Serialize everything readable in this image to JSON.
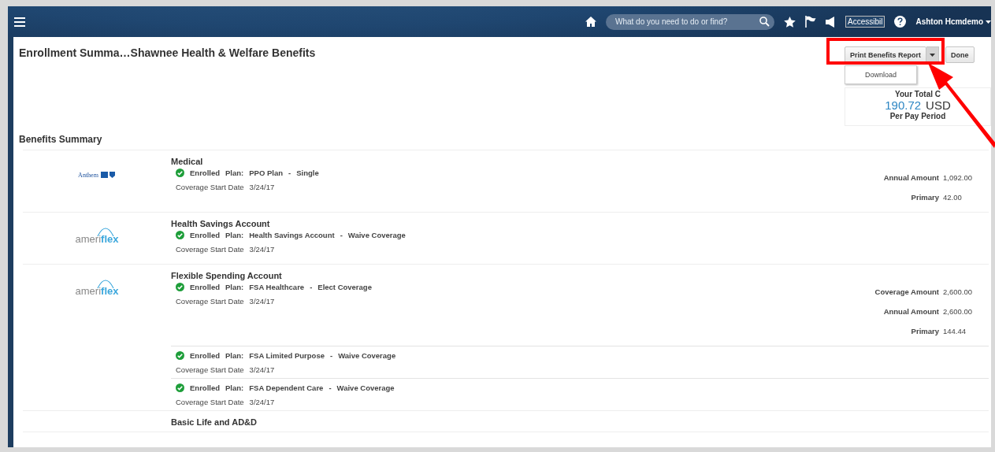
{
  "header": {
    "search": {
      "placeholder": "What do you need to do or find?"
    },
    "accessibility_image": "Accessibil",
    "user": "Ashton Hcmdemo"
  },
  "page": {
    "title": "Enrollment Summa…Shawnee Health & Welfare Benefits",
    "print_button": "Print Benefits Report",
    "done_button": "Done",
    "menu": {
      "expanded": true,
      "items": [
        "Download"
      ]
    }
  },
  "total_cost": {
    "label": "Your Total C",
    "amount": "190.72",
    "currency": "USD",
    "period": "Per Pay Period"
  },
  "section_title": "Benefits Summary",
  "benefits": [
    {
      "title": "Medical",
      "logo": {
        "kind": "anthem",
        "text": "Anthem"
      },
      "plans": [
        {
          "enrolled": true,
          "status": "Enrolled",
          "plan_label": "Plan:",
          "plan": "PPO Plan",
          "separator": "-",
          "option": "Single",
          "date_label": "Coverage Start Date",
          "date": "3/24/17",
          "amounts": [
            {
              "label": "Annual Amount",
              "value": "1,092.00"
            },
            {
              "label": "Primary",
              "value": "42.00"
            }
          ]
        }
      ]
    },
    {
      "title": "Health Savings Account",
      "logo": {
        "kind": "ameriflex",
        "text": "ameri",
        "accent": "flex"
      },
      "plans": [
        {
          "enrolled": true,
          "status": "Enrolled",
          "plan_label": "Plan:",
          "plan": "Health Savings Account",
          "separator": "-",
          "option": "Waive Coverage",
          "date_label": "Coverage Start Date",
          "date": "3/24/17"
        }
      ]
    },
    {
      "title": "Flexible Spending Account",
      "logo": {
        "kind": "ameriflex",
        "text": "ameri",
        "accent": "flex"
      },
      "plans": [
        {
          "enrolled": true,
          "status": "Enrolled",
          "plan_label": "Plan:",
          "plan": "FSA Healthcare",
          "separator": "-",
          "option": "Elect Coverage",
          "date_label": "Coverage Start Date",
          "date": "3/24/17",
          "amounts": [
            {
              "label": "Coverage Amount",
              "value": "2,600.00"
            },
            {
              "label": "Annual Amount",
              "value": "2,600.00"
            },
            {
              "label": "Primary",
              "value": "144.44"
            }
          ]
        },
        {
          "enrolled": true,
          "status": "Enrolled",
          "plan_label": "Plan:",
          "plan": "FSA Limited Purpose",
          "separator": "-",
          "option": "Waive Coverage",
          "date_label": "Coverage Start Date",
          "date": "3/24/17"
        },
        {
          "enrolled": true,
          "status": "Enrolled",
          "plan_label": "Plan:",
          "plan": "FSA Dependent Care",
          "separator": "-",
          "option": "Waive Coverage",
          "date_label": "Coverage Start Date",
          "date": "3/24/17"
        }
      ]
    },
    {
      "title": "Basic Life and AD&D"
    }
  ],
  "annotation": {
    "highlight": true,
    "arrow": true
  }
}
